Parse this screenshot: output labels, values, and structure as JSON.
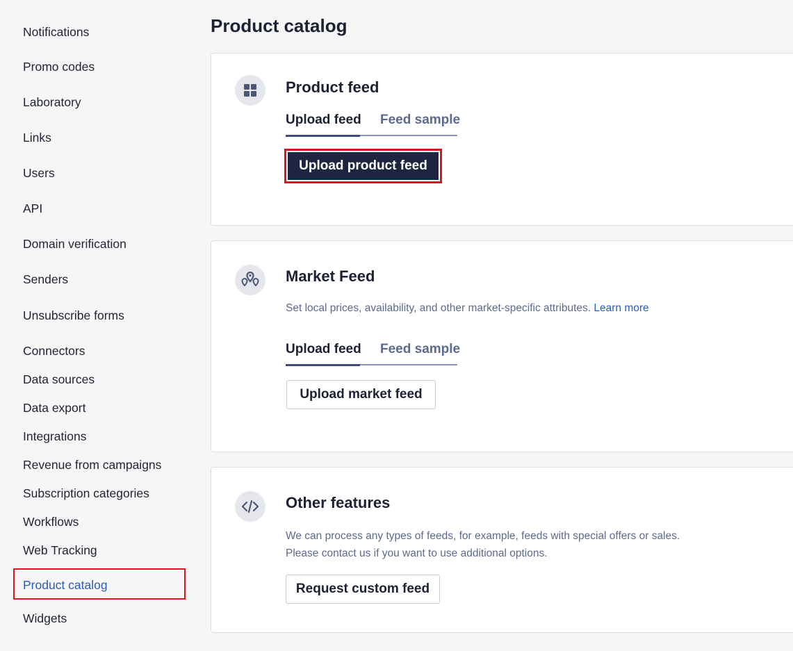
{
  "sidebar": {
    "items": [
      {
        "label": "Notifications"
      },
      {
        "label": "Promo codes"
      },
      {
        "label": "Laboratory"
      },
      {
        "label": "Links"
      },
      {
        "label": "Users"
      },
      {
        "label": "API"
      },
      {
        "label": "Domain verification"
      },
      {
        "label": "Senders"
      },
      {
        "label": "Unsubscribe forms"
      },
      {
        "label": "Connectors"
      },
      {
        "label": "Data sources"
      },
      {
        "label": "Data export"
      },
      {
        "label": "Integrations"
      },
      {
        "label": "Revenue from campaigns"
      },
      {
        "label": "Subscription categories"
      },
      {
        "label": "Workflows"
      },
      {
        "label": "Web Tracking"
      },
      {
        "label": "Product catalog",
        "active": true
      },
      {
        "label": "Widgets"
      }
    ]
  },
  "page": {
    "title": "Product catalog"
  },
  "product_feed": {
    "icon": "grid-icon",
    "title": "Product feed",
    "tabs": [
      {
        "label": "Upload feed",
        "active": true
      },
      {
        "label": "Feed sample",
        "active": false
      }
    ],
    "button_label": "Upload product feed"
  },
  "market_feed": {
    "icon": "map-pins-icon",
    "title": "Market Feed",
    "description": "Set local prices, availability, and other market-specific attributes.",
    "learn_more": "Learn more",
    "tabs": [
      {
        "label": "Upload feed",
        "active": true
      },
      {
        "label": "Feed sample",
        "active": false
      }
    ],
    "button_label": "Upload market feed"
  },
  "other_features": {
    "icon": "code-icon",
    "title": "Other features",
    "description_line1": "We can process any types of feeds, for example, feeds with special offers or sales.",
    "description_line2": "Please contact us if you want to use additional options.",
    "button_label": "Request custom feed"
  },
  "colors": {
    "primary_button": "#1e2540",
    "highlight": "#e0141c",
    "link": "#2b5cb8",
    "muted_text": "#5b6a8e"
  }
}
